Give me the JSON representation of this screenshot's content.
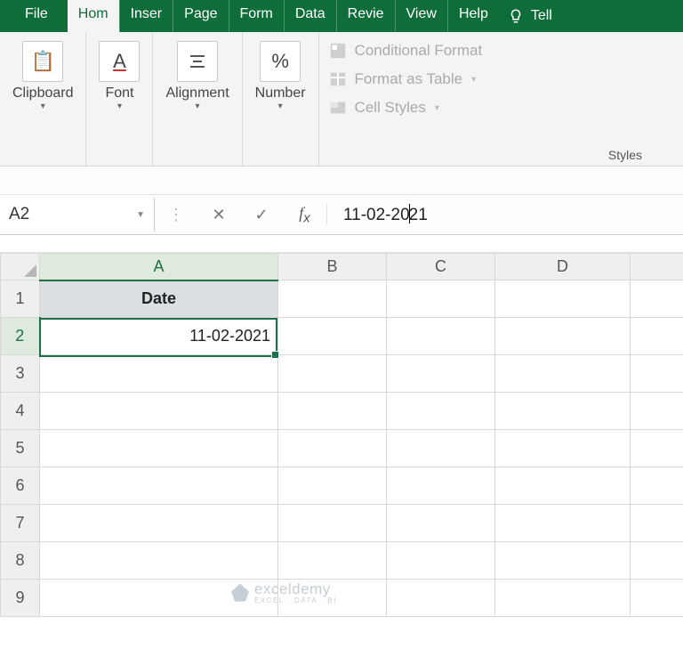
{
  "tabs": {
    "file": "File",
    "home": "Hom",
    "insert": "Inser",
    "page": "Page",
    "formulas": "Form",
    "data": "Data",
    "review": "Revie",
    "view": "View",
    "help": "Help",
    "tell": "Tell"
  },
  "ribbon": {
    "clipboard": {
      "label": "Clipboard",
      "icon": "📋"
    },
    "font": {
      "label": "Font",
      "icon": "A"
    },
    "alignment": {
      "label": "Alignment",
      "icon": "≡"
    },
    "number": {
      "label": "Number",
      "icon": "%"
    },
    "styles": {
      "cond_format": "Conditional Format",
      "format_table": "Format as Table",
      "cell_styles": "Cell Styles",
      "group_label": "Styles"
    }
  },
  "formula_bar": {
    "name_box": "A2",
    "value": "11-02-2021",
    "value_before_caret": "11-02-20",
    "value_after_caret": "21"
  },
  "columns": [
    "A",
    "B",
    "C",
    "D"
  ],
  "rows": [
    "1",
    "2",
    "3",
    "4",
    "5",
    "6",
    "7",
    "8",
    "9"
  ],
  "cells": {
    "A1": "Date",
    "A2": "11-02-2021"
  },
  "selected_cell": "A2",
  "watermark": {
    "name": "exceldemy",
    "sub": "EXCEL · DATA · BI"
  },
  "chart_data": {
    "type": "table",
    "columns": [
      "Date"
    ],
    "rows": [
      [
        "11-02-2021"
      ]
    ]
  }
}
